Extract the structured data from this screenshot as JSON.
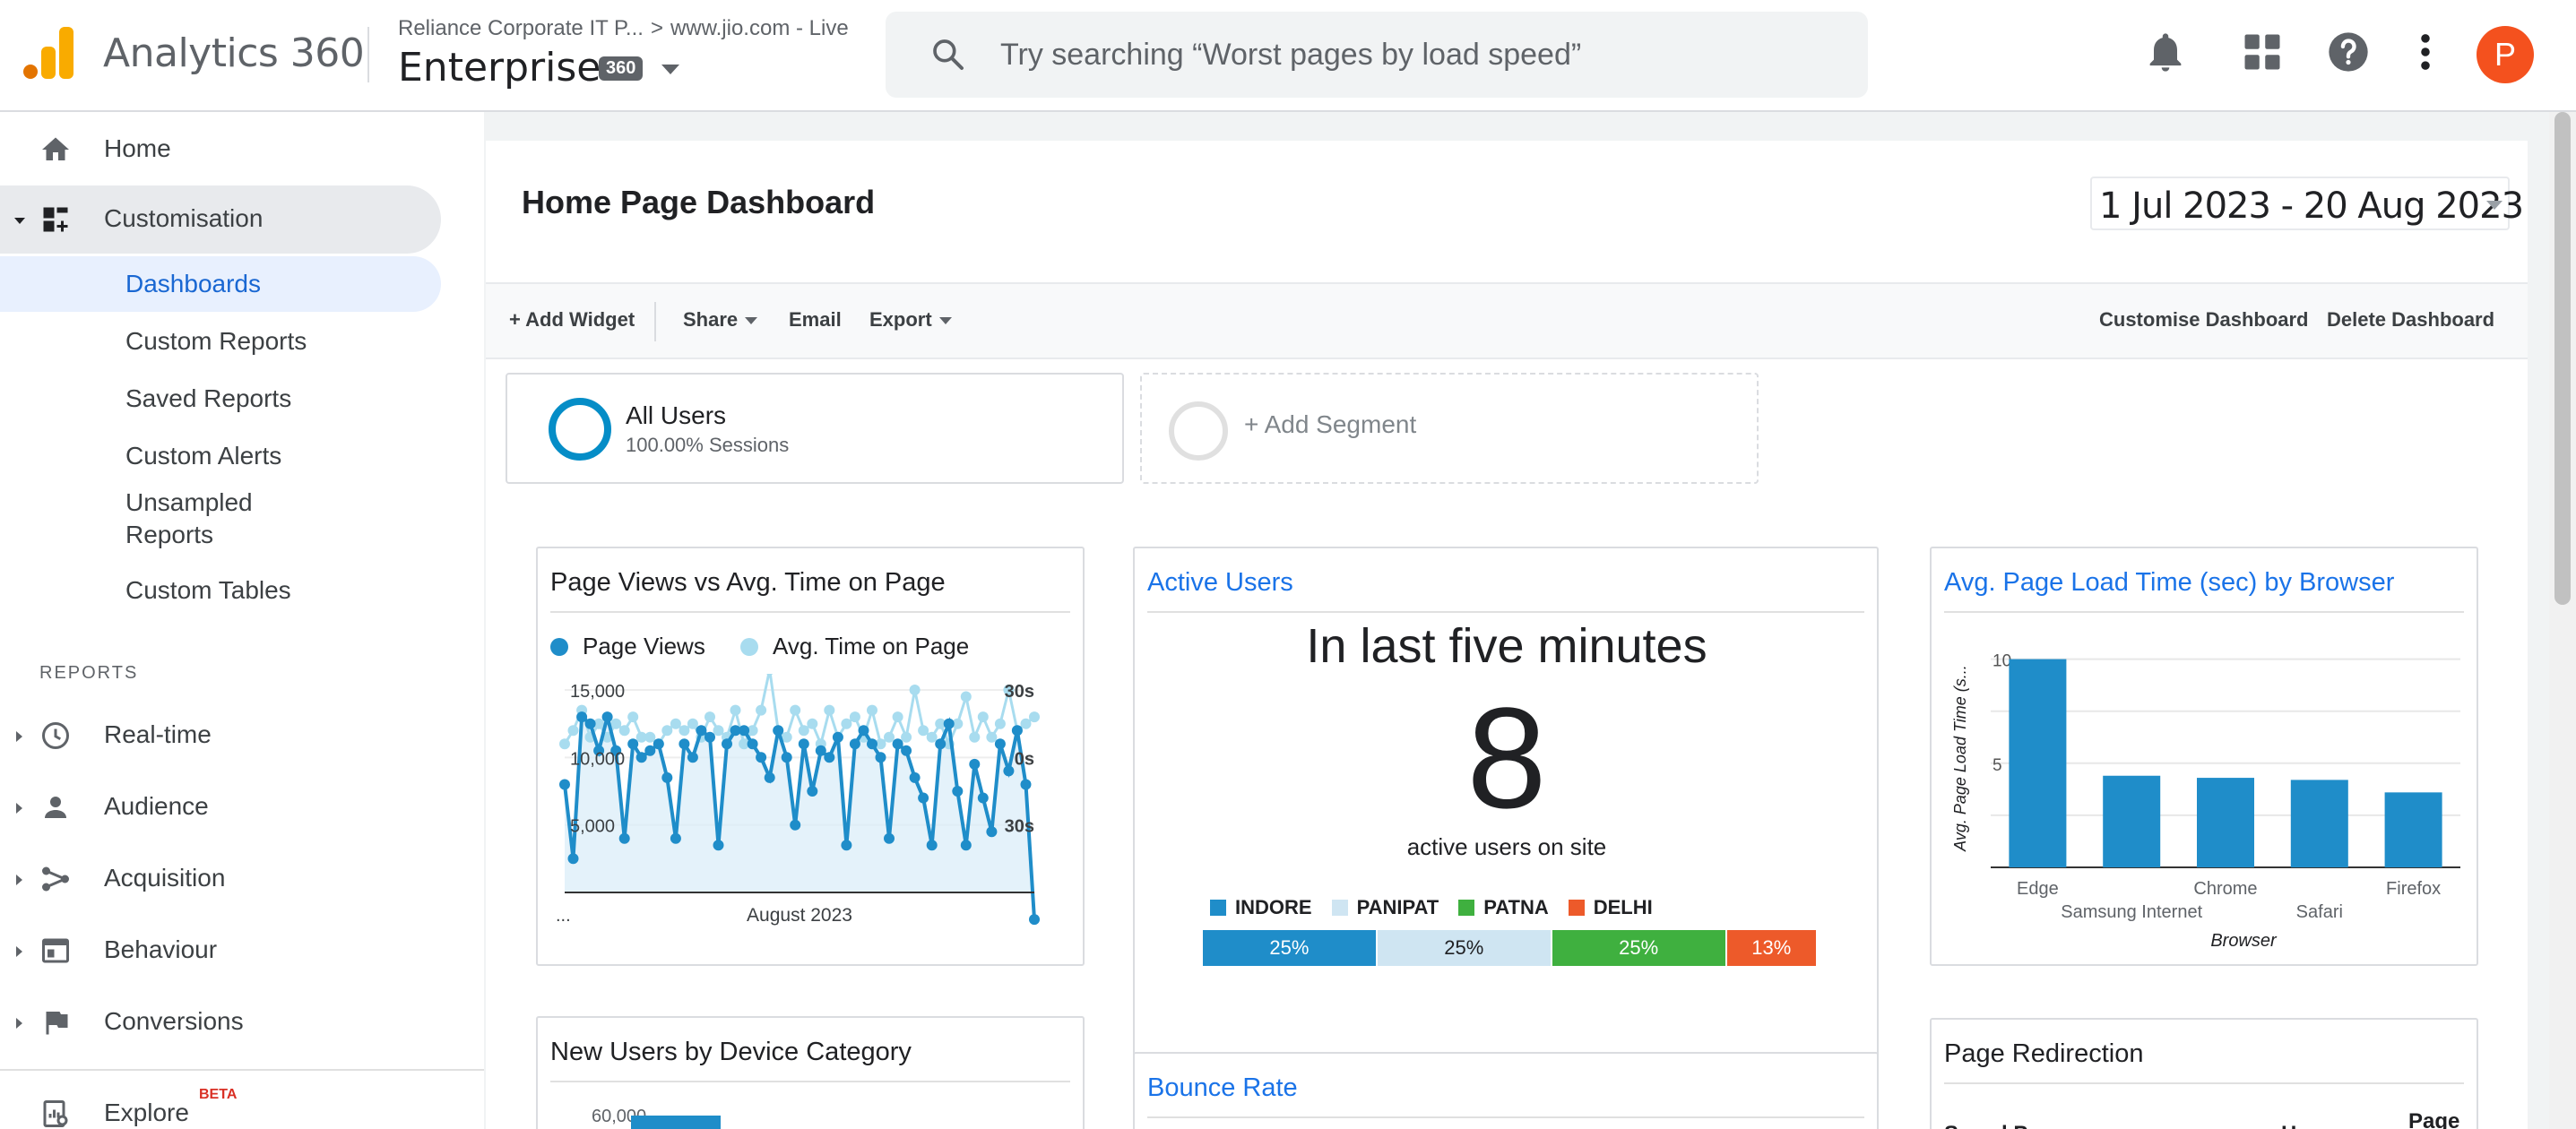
{
  "app": {
    "title": "Analytics 360",
    "account_crumb": "Reliance Corporate IT P...",
    "property_crumb": "www.jio.com - Live",
    "view_name": "Enterprise",
    "view_badge": "360"
  },
  "search": {
    "placeholder": "Try searching “Worst pages by load speed”"
  },
  "user": {
    "avatar_letter": "P",
    "avatar_color": "#f4511e"
  },
  "sidebar": {
    "home": "Home",
    "customisation": "Customisation",
    "custom_sub": [
      "Dashboards",
      "Custom Reports",
      "Saved Reports",
      "Custom Alerts",
      "Unsampled Reports",
      "Custom Tables"
    ],
    "reports_heading": "REPORTS",
    "reports": [
      "Real-time",
      "Audience",
      "Acquisition",
      "Behaviour",
      "Conversions"
    ],
    "explore": "Explore",
    "explore_badge": "BETA"
  },
  "dashboard": {
    "title": "Home Page Dashboard",
    "date_range": "1 Jul 2023 - 20 Aug 2023",
    "toolbar": {
      "add_widget": "+ Add Widget",
      "share": "Share",
      "email": "Email",
      "export": "Export",
      "customise": "Customise Dashboard",
      "delete": "Delete Dashboard"
    },
    "segments": {
      "all_users": "All Users",
      "all_users_sub": "100.00% Sessions",
      "add_segment": "+ Add Segment"
    }
  },
  "widgets": {
    "pageviews": {
      "title": "Page Views vs Avg. Time on Page",
      "legend_a": "Page Views",
      "legend_b": "Avg. Time on Page",
      "y_left": [
        "15,000",
        "10,000",
        "5,000"
      ],
      "y_right": [
        "30s",
        "0s",
        "30s"
      ],
      "x_label": "August 2023",
      "x_ellipsis": "..."
    },
    "active_users": {
      "title": "Active Users",
      "headline": "In last five minutes",
      "count": "8",
      "caption": "active users on site",
      "segments": [
        {
          "name": "INDORE",
          "pct": "25%",
          "value": 25,
          "color": "#1f8dc9",
          "text_color": "#ffffff"
        },
        {
          "name": "PANIPAT",
          "pct": "25%",
          "value": 25,
          "color": "#cfe5f2",
          "text_color": "#202124"
        },
        {
          "name": "PATNA",
          "pct": "25%",
          "value": 25,
          "color": "#3fb03f",
          "text_color": "#ffffff"
        },
        {
          "name": "DELHI",
          "pct": "13%",
          "value": 13,
          "color": "#ed5a2a",
          "text_color": "#ffffff"
        }
      ]
    },
    "load_time": {
      "title": "Avg. Page Load Time (sec) by Browser",
      "y_axis_label": "Avg. Page Load Time (s...",
      "x_axis_label": "Browser",
      "tick_10": "10",
      "tick_5": "5"
    },
    "new_users": {
      "title": "New Users by Device Category",
      "tick_top": "60,000"
    },
    "bounce_rate": {
      "title": "Bounce Rate"
    },
    "redirection": {
      "title": "Page Redirection",
      "col_a": "Saved Pa...",
      "col_b": "H...",
      "col_c": "Page"
    }
  },
  "chart_data": [
    {
      "type": "bar",
      "title": "Avg. Page Load Time (sec) by Browser",
      "xlabel": "Browser",
      "ylabel": "Avg. Page Load Time (s...",
      "categories": [
        "Edge",
        "Samsung Internet",
        "Chrome",
        "Safari",
        "Firefox"
      ],
      "values": [
        10,
        4.4,
        4.3,
        4.2,
        3.6
      ],
      "ylim": [
        0,
        10.5
      ],
      "color": "#1f8dc9"
    },
    {
      "type": "line",
      "title": "Page Views vs Avg. Time on Page",
      "x_label": "August 2023",
      "series": [
        {
          "name": "Page Views",
          "color": "#1f8dc9",
          "values": [
            8000,
            2500,
            13000,
            12500,
            10500,
            13000,
            10500,
            4000,
            11000,
            10000,
            10500,
            11000,
            8500,
            4000,
            11000,
            10000,
            12000,
            11500,
            3500,
            11000,
            12000,
            12000,
            11000,
            10000,
            8500,
            12000,
            10000,
            5000,
            11000,
            7500,
            10500,
            10000,
            11500,
            3500,
            11000,
            12000,
            11000,
            10000,
            4000,
            11000,
            10500,
            8500,
            7000,
            3500,
            11000,
            12500,
            7500,
            3500,
            9500,
            7000,
            4500,
            11000,
            9000,
            12000,
            8000,
            -2000
          ]
        },
        {
          "name": "Avg. Time on Page",
          "color": "#a8dcef",
          "values": [
            11000,
            12000,
            13500,
            11500,
            12500,
            11500,
            12500,
            12000,
            13000,
            11500,
            11500,
            11000,
            12000,
            12500,
            12000,
            12500,
            11500,
            13000,
            12000,
            11500,
            13500,
            11000,
            12000,
            13500,
            16500,
            12000,
            11500,
            13500,
            12000,
            12500,
            11000,
            13500,
            11500,
            12500,
            13000,
            11500,
            13500,
            11000,
            11500,
            13000,
            11500,
            15000,
            12000,
            11500,
            12500,
            11000,
            12500,
            14500,
            11500,
            13000,
            11500,
            12500,
            15000,
            12000,
            12500,
            13000
          ]
        }
      ],
      "ylim": [
        0,
        15000
      ]
    }
  ]
}
